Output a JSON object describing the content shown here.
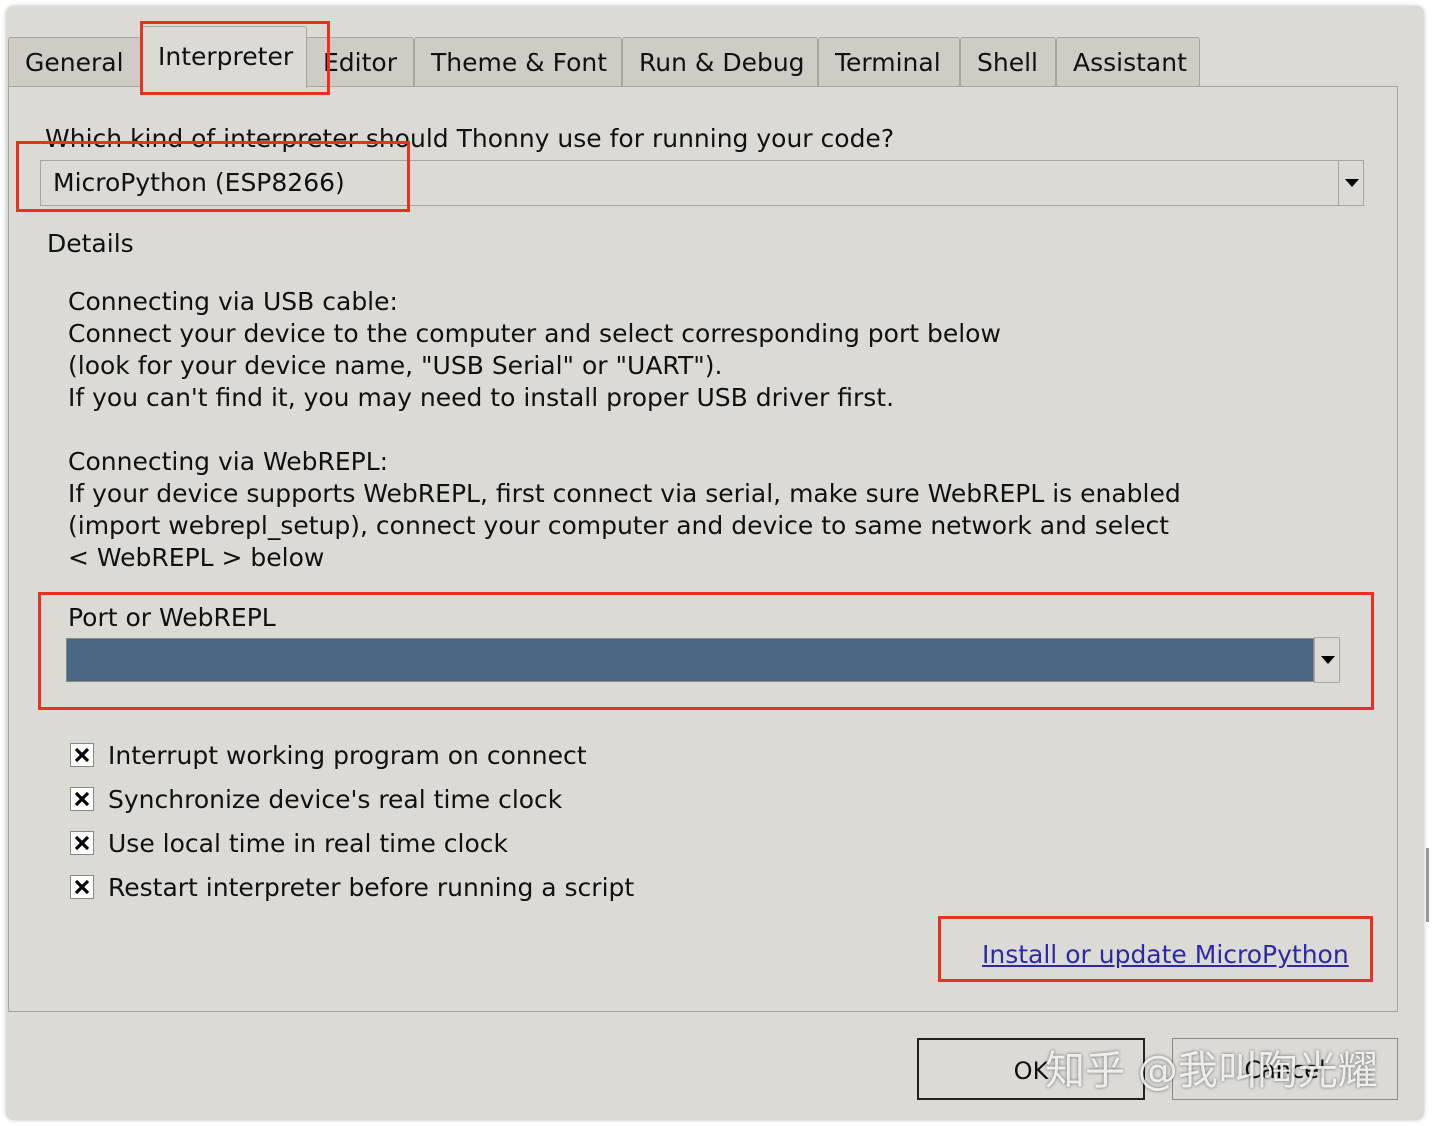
{
  "tabs": [
    {
      "label": "General"
    },
    {
      "label": "Interpreter"
    },
    {
      "label": "Editor"
    },
    {
      "label": "Theme & Font"
    },
    {
      "label": "Run & Debug"
    },
    {
      "label": "Terminal"
    },
    {
      "label": "Shell"
    },
    {
      "label": "Assistant"
    }
  ],
  "interpreter": {
    "question": "Which kind of interpreter should Thonny use for running your code?",
    "selected": "MicroPython (ESP8266)"
  },
  "details": {
    "heading": "Details",
    "usb_lines": [
      "Connecting via USB cable:",
      "Connect your device to the computer and select corresponding port below",
      "(look for your device name, \"USB Serial\" or \"UART\").",
      "If you can't find it, you may need to install proper USB driver first."
    ],
    "webrepl_lines": [
      "Connecting via WebREPL:",
      "If your device supports WebREPL, first connect via serial, make sure WebREPL is enabled",
      "(import webrepl_setup), connect your computer and device to same network and select",
      "< WebREPL > below"
    ]
  },
  "port": {
    "label": "Port or WebREPL",
    "value": ""
  },
  "options": [
    {
      "label": "Interrupt working program on connect",
      "checked": true
    },
    {
      "label": "Synchronize device's real time clock",
      "checked": true
    },
    {
      "label": "Use local time in real time clock",
      "checked": true
    },
    {
      "label": "Restart interpreter before running a script",
      "checked": true
    }
  ],
  "install_link": "Install or update MicroPython",
  "buttons": {
    "ok": "OK",
    "cancel": "Cancel"
  },
  "watermark": "知乎 @我叫陶光耀",
  "colors": {
    "highlight": "#e8321e",
    "port_selection": "#4a6784",
    "link": "#2a2aa5"
  }
}
